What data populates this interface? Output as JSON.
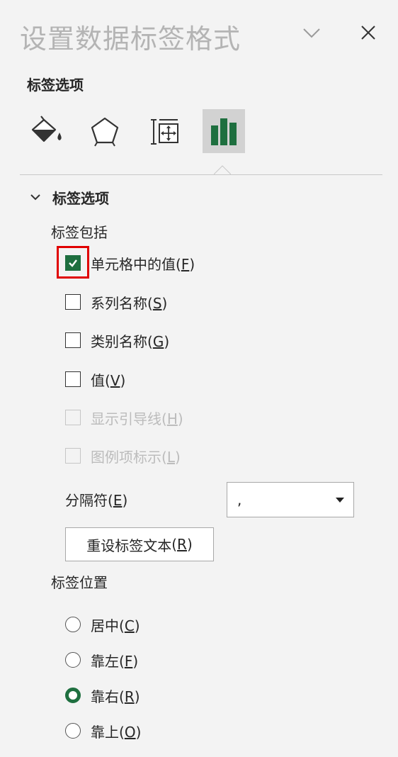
{
  "pane": {
    "title": "设置数据标签格式",
    "dropdown_icon": "chevron-down-icon",
    "close_icon": "close-icon"
  },
  "section_heading": "标签选项",
  "icon_tabs": [
    {
      "icon": "fill-bucket-icon",
      "selected": false
    },
    {
      "icon": "pentagon-effects-icon",
      "selected": false
    },
    {
      "icon": "size-properties-icon",
      "selected": false
    },
    {
      "icon": "bar-chart-icon",
      "selected": true
    }
  ],
  "group": {
    "title": "标签选项",
    "expanded": true,
    "label_contains_heading": "标签包括",
    "checkboxes": [
      {
        "label": "单元格中的值",
        "key": "F",
        "checked": true,
        "disabled": false
      },
      {
        "label": "系列名称",
        "key": "S",
        "checked": false,
        "disabled": false
      },
      {
        "label": "类别名称",
        "key": "G",
        "checked": false,
        "disabled": false
      },
      {
        "label": "值",
        "key": "V",
        "checked": false,
        "disabled": false
      },
      {
        "label": "显示引导线",
        "key": "H",
        "checked": false,
        "disabled": true
      },
      {
        "label": "图例项标示",
        "key": "L",
        "checked": false,
        "disabled": true
      }
    ],
    "separator": {
      "label": "分隔符",
      "key": "E",
      "value": ","
    },
    "reset_button": {
      "label": "重设标签文本",
      "key": "R"
    },
    "position_heading": "标签位置",
    "radios": [
      {
        "label": "居中",
        "key": "C",
        "selected": false
      },
      {
        "label": "靠左",
        "key": "F",
        "selected": false
      },
      {
        "label": "靠右",
        "key": "R",
        "selected": true
      },
      {
        "label": "靠上",
        "key": "O",
        "selected": false
      }
    ]
  },
  "colors": {
    "accent_green": "#1e6f3f",
    "highlight_red": "#e00000",
    "pane_bg": "#f3f3f3"
  }
}
